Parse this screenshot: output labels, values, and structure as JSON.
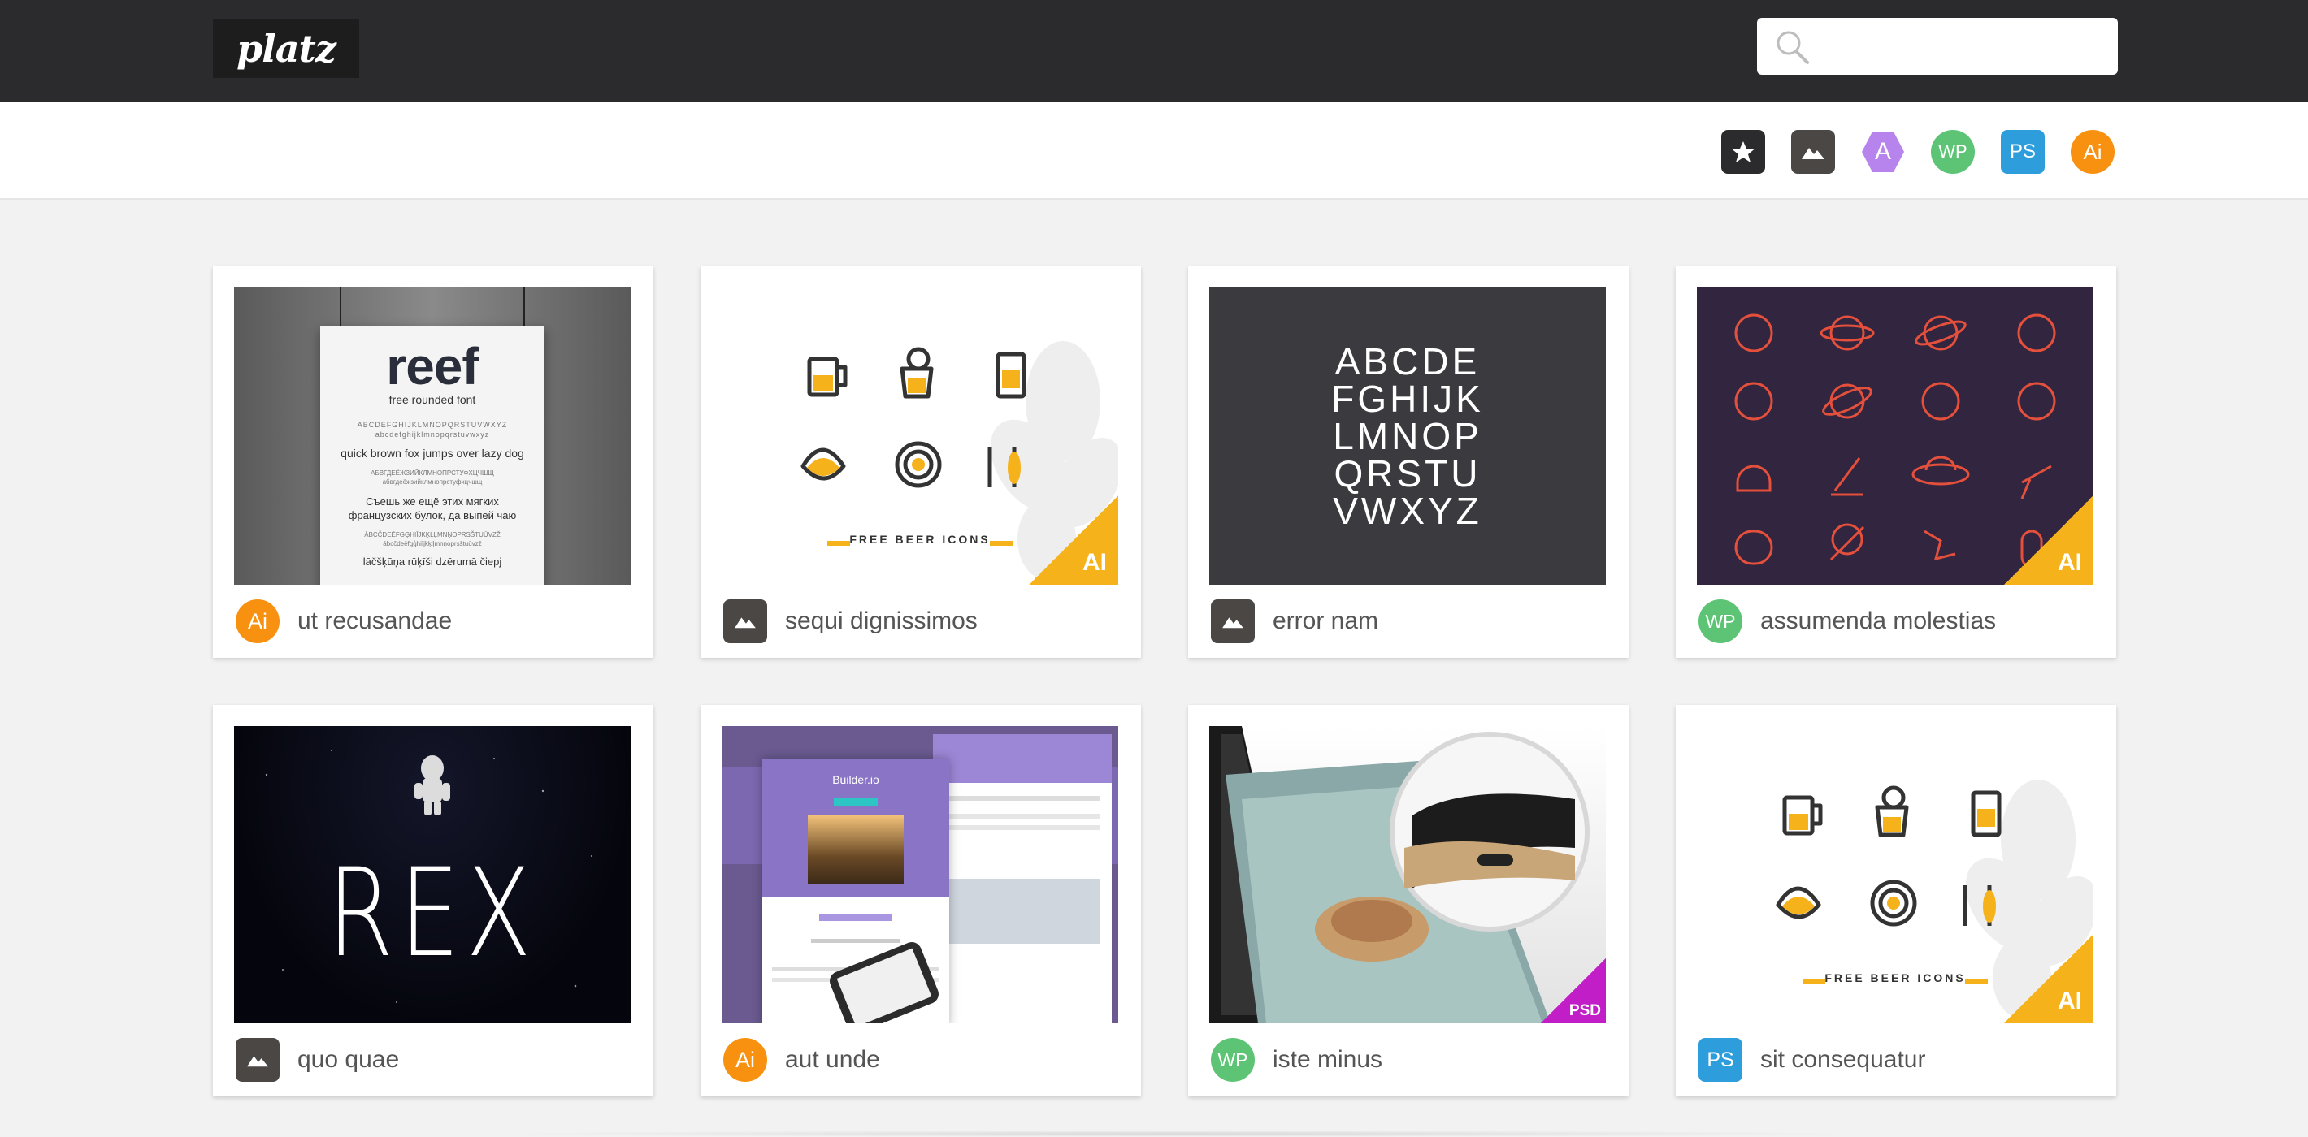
{
  "header": {
    "logo_text": "platz",
    "search": {
      "placeholder": "",
      "value": ""
    }
  },
  "filters": [
    {
      "name": "featured",
      "icon": "star-icon",
      "label": "",
      "color": "#2b2b2d"
    },
    {
      "name": "images",
      "icon": "image-icon",
      "label": "",
      "color": "#4a4745"
    },
    {
      "name": "font",
      "icon": "font-icon",
      "label": "A",
      "color": "#b684ec"
    },
    {
      "name": "wordpress",
      "icon": "wordpress-icon",
      "label": "WP",
      "color": "#5dc475"
    },
    {
      "name": "photoshop",
      "icon": "photoshop-icon",
      "label": "PS",
      "color": "#2d9ddb"
    },
    {
      "name": "illustrator",
      "icon": "illustrator-icon",
      "label": "Ai",
      "color": "#f7910f"
    }
  ],
  "cards": [
    {
      "title": "ut recusandae",
      "badge": "Ai",
      "badge_type": "illustrator",
      "thumb": "reef-font-poster"
    },
    {
      "title": "sequi dignissimos",
      "badge": "",
      "badge_type": "image",
      "thumb": "beer-icons"
    },
    {
      "title": "error nam",
      "badge": "",
      "badge_type": "image",
      "thumb": "alphabet-font"
    },
    {
      "title": "assumenda molestias",
      "badge": "WP",
      "badge_type": "wordpress",
      "thumb": "space-icons"
    },
    {
      "title": "quo quae",
      "badge": "",
      "badge_type": "image",
      "thumb": "rex-font"
    },
    {
      "title": "aut unde",
      "badge": "Ai",
      "badge_type": "illustrator",
      "thumb": "website-mockup"
    },
    {
      "title": "iste minus",
      "badge": "WP",
      "badge_type": "wordpress",
      "thumb": "laptop-mockup"
    },
    {
      "title": "sit consequatur",
      "badge": "PS",
      "badge_type": "photoshop",
      "thumb": "beer-icons"
    }
  ],
  "thumbs": {
    "reef": {
      "title": "reef",
      "subtitle": "free rounded font",
      "line1": "ABCDEFGHIJKLMNOPQRSTUVWXYZ",
      "line2": "abcdefghijklmnopqrstuvwxyz",
      "pangram": "quick brown fox jumps over lazy dog",
      "line3": "АБВГДЕЁЖЗИЙКЛМНОПРСТУФХЦЧШЩ",
      "line4": "абвгдеёжзийклмнопрстуфхцчшщ",
      "cyr1": "Съешь же ещё этих мягких",
      "cyr2": "французских булок, да выпей чаю",
      "line5": "ĀBCČDEĒFGĢHIĪJKĶLĻMNŅOPRSŠTUŪVZŽ",
      "line6": "ābcčdeēfgģhiījkķlļmnņoprsštuūvzž",
      "lv": "lāčšķūņa rūķīši dzērumā čiepj"
    },
    "beer": {
      "caption": "FREE BEER ICONS",
      "corner": "AI"
    },
    "alphabet": {
      "rows": [
        "ABCDE",
        "FGHIJK",
        "LMNOP",
        "QRSTU",
        "VWXYZ"
      ]
    },
    "space": {
      "corner": "AI"
    },
    "rex": {
      "title": "REX"
    },
    "website": {
      "headline": "Builder.io"
    },
    "laptop": {
      "corner": "PSD"
    }
  },
  "colors": {
    "illustrator": "#f7910f",
    "wordpress": "#5dc475",
    "photoshop": "#2d9ddb",
    "image": "#4a4745",
    "ai_corner": "#f6b21b",
    "psd_corner": "#c21ec8"
  }
}
